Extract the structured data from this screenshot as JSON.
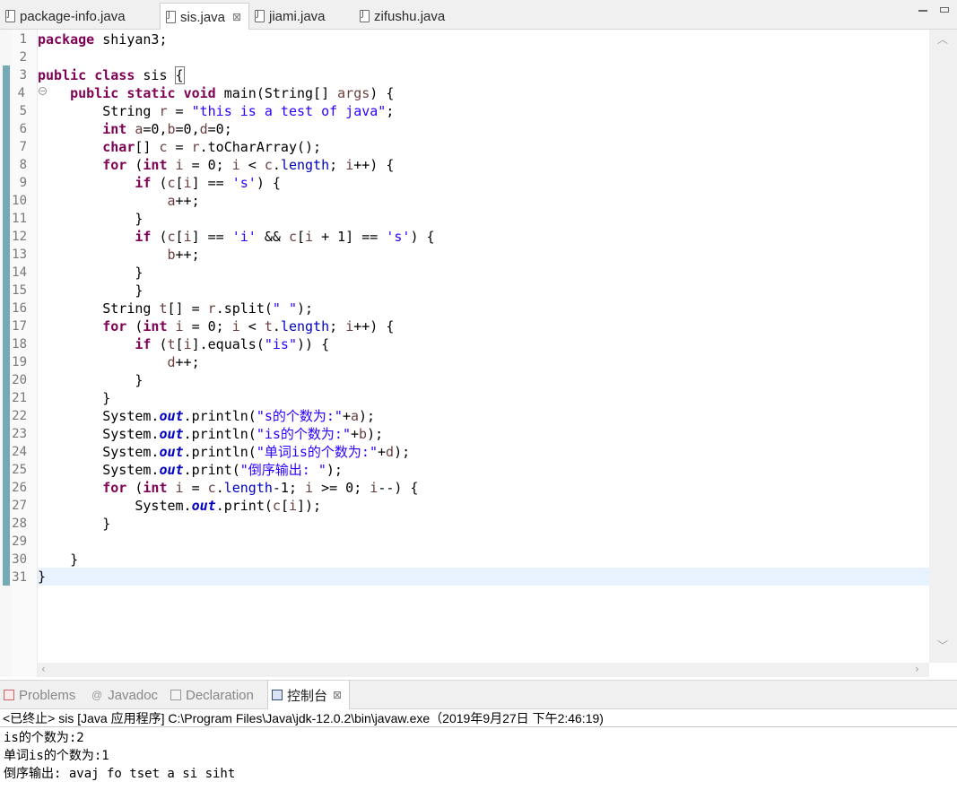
{
  "editor_tabs": [
    {
      "label": "package-info.java"
    },
    {
      "label": "sis.java",
      "close": "⊠"
    },
    {
      "label": "jiami.java"
    },
    {
      "label": "zifushu.java"
    }
  ],
  "icons": {
    "java_file": "java-file-icon",
    "fold": "collapse-fold-icon",
    "problems": "problems-icon",
    "javadoc": "javadoc-icon",
    "declaration": "declaration-icon",
    "console": "console-icon"
  },
  "colors": {
    "keyword": "#7f0055",
    "string": "#2a00ff",
    "field": "#0000c0",
    "local_variable": "#6a3e3e",
    "current_line": "#e8f2fe",
    "change_bar": "#74a9b6"
  },
  "line_numbers": [
    "1",
    "2",
    "3",
    "4",
    "5",
    "6",
    "7",
    "8",
    "9",
    "10",
    "11",
    "12",
    "13",
    "14",
    "15",
    "16",
    "17",
    "18",
    "19",
    "20",
    "21",
    "22",
    "23",
    "24",
    "25",
    "26",
    "27",
    "28",
    "29",
    "30",
    "31"
  ],
  "code": {
    "l1": {
      "kw": "package",
      "rest": " shiyan3;"
    },
    "l3": {
      "kw1": "public",
      "kw2": "class",
      "rest": " sis ",
      "brace": "{"
    },
    "l4": {
      "indent": "    ",
      "kw1": "public",
      "kw2": "static",
      "kw3": "void",
      "rest": " main(String[] ",
      "args": "args",
      "end": ") {"
    },
    "l5": {
      "indent": "        ",
      "type": "String ",
      "var": "r",
      "eq": " = ",
      "str": "\"this is a test of java\"",
      "end": ";"
    },
    "l6": {
      "indent": "        ",
      "kw": "int",
      "a": "a",
      "p1": "=0,",
      "b": "b",
      "p2": "=0,",
      "d": "d",
      "p3": "=0;"
    },
    "l7": {
      "indent": "        ",
      "kw": "char",
      "p1": "[] ",
      "c": "c",
      "p2": " = ",
      "r": "r",
      "p3": ".toCharArray();"
    },
    "l8": {
      "indent": "        ",
      "kw": "for",
      "p1": " (",
      "kw2": "int",
      "i1": "i",
      "p2": " = 0; ",
      "i2": "i",
      "p3": " < ",
      "c": "c",
      "p4": ".",
      "fld": "length",
      "p5": "; ",
      "i3": "i",
      "p6": "++) {"
    },
    "l9": {
      "indent": "            ",
      "kw": "if",
      "p1": " (",
      "c": "c",
      "p2": "[",
      "i": "i",
      "p3": "] == ",
      "str": "'s'",
      "p4": ") {"
    },
    "l10": {
      "indent": "                ",
      "a": "a",
      "p1": "++;"
    },
    "l11": {
      "indent": "            ",
      "p1": "}"
    },
    "l12": {
      "indent": "            ",
      "kw": "if",
      "p1": " (",
      "c1": "c",
      "p2": "[",
      "i1": "i",
      "p3": "] == ",
      "str1": "'i'",
      "p4": " && ",
      "c2": "c",
      "p5": "[",
      "i2": "i",
      "p6": " + 1] == ",
      "str2": "'s'",
      "p7": ") {"
    },
    "l13": {
      "indent": "                ",
      "b": "b",
      "p1": "++;"
    },
    "l14": {
      "indent": "            ",
      "p1": "}"
    },
    "l15": {
      "indent": "            ",
      "p1": "}"
    },
    "l16": {
      "indent": "        ",
      "type": "String ",
      "t": "t",
      "p1": "[] = ",
      "r": "r",
      "p2": ".split(",
      "str": "\" \"",
      "p3": ");"
    },
    "l17": {
      "indent": "        ",
      "kw": "for",
      "p1": " (",
      "kw2": "int",
      "i1": "i",
      "p2": " = 0; ",
      "i2": "i",
      "p3": " < ",
      "t": "t",
      "p4": ".",
      "fld": "length",
      "p5": "; ",
      "i3": "i",
      "p6": "++) {"
    },
    "l18": {
      "indent": "            ",
      "kw": "if",
      "p1": " (",
      "t": "t",
      "p2": "[",
      "i": "i",
      "p3": "].equals(",
      "str": "\"is\"",
      "p4": ")) {"
    },
    "l19": {
      "indent": "                ",
      "d": "d",
      "p1": "++;"
    },
    "l20": {
      "indent": "            ",
      "p1": "}"
    },
    "l21": {
      "indent": "        ",
      "p1": "}"
    },
    "l22": {
      "indent": "        ",
      "p1": "System.",
      "out": "out",
      "p2": ".println(",
      "str": "\"s的个数为:\"",
      "p3": "+",
      "v": "a",
      "p4": ");"
    },
    "l23": {
      "indent": "        ",
      "p1": "System.",
      "out": "out",
      "p2": ".println(",
      "str": "\"is的个数为:\"",
      "p3": "+",
      "v": "b",
      "p4": ");"
    },
    "l24": {
      "indent": "        ",
      "p1": "System.",
      "out": "out",
      "p2": ".println(",
      "str": "\"单词is的个数为:\"",
      "p3": "+",
      "v": "d",
      "p4": ");"
    },
    "l25": {
      "indent": "        ",
      "p1": "System.",
      "out": "out",
      "p2": ".print(",
      "str": "\"倒序输出: \"",
      "p3": ");"
    },
    "l26": {
      "indent": "        ",
      "kw": "for",
      "p1": " (",
      "kw2": "int",
      "i1": "i",
      "p2": " = ",
      "c": "c",
      "p3": ".",
      "fld": "length",
      "p4": "-1; ",
      "i2": "i",
      "p5": " >= 0; ",
      "i3": "i",
      "p6": "--) {"
    },
    "l27": {
      "indent": "            ",
      "p1": "System.",
      "out": "out",
      "p2": ".print(",
      "c": "c",
      "p3": "[",
      "i": "i",
      "p4": "]);"
    },
    "l28": {
      "indent": "        ",
      "p1": "}"
    },
    "l30": {
      "indent": "    ",
      "p1": "}"
    },
    "l31": {
      "p1": "}"
    }
  },
  "view_tabs": [
    {
      "label": "Problems"
    },
    {
      "label": "Javadoc",
      "glyph": "@"
    },
    {
      "label": "Declaration"
    },
    {
      "label": "控制台",
      "close": "⊠"
    }
  ],
  "console": {
    "header": "<已终止> sis [Java 应用程序] C:\\Program Files\\Java\\jdk-12.0.2\\bin\\javaw.exe（2019年9月27日 下午2:46:19)",
    "lines": [
      "is的个数为:2",
      "单词is的个数为:1",
      "倒序输出: avaj fo tset a si siht"
    ]
  }
}
